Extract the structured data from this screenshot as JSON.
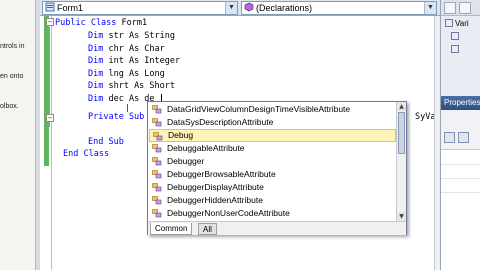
{
  "toolbox": {
    "text_lines": [
      "ntrols in",
      "en onto",
      "olbox."
    ]
  },
  "editor": {
    "class_dropdown": {
      "value": "Form1",
      "icon": "class-icon"
    },
    "method_dropdown": {
      "value": "(Declarations)",
      "icon": "method-icon"
    },
    "code_lines": [
      {
        "kw": "Public Class",
        "rest": " Form1"
      },
      {
        "kw": "Dim",
        "rest": " str As String"
      },
      {
        "kw": "Dim",
        "rest": " chr As Char"
      },
      {
        "kw": "Dim",
        "rest": " int As Integer"
      },
      {
        "kw": "Dim",
        "rest": " lng As Long"
      },
      {
        "kw": "Dim",
        "rest": " shrt As Short"
      },
      {
        "kw": "Dim",
        "rest": " dec As de"
      },
      {
        "kw": "Private Sub",
        "rest": ""
      },
      {
        "kw": "End Sub",
        "rest": ""
      },
      {
        "kw": "End Class",
        "rest": ""
      }
    ],
    "overflow_text": "SyVa"
  },
  "intellisense": {
    "items": [
      {
        "label": "DataGridViewColumnDesignTimeVisibleAttribute",
        "icon": "class-icon"
      },
      {
        "label": "DataSysDescriptionAttribute",
        "icon": "class-icon"
      },
      {
        "label": "Debug",
        "icon": "class-icon",
        "selected": true
      },
      {
        "label": "DebuggableAttribute",
        "icon": "class-icon"
      },
      {
        "label": "Debugger",
        "icon": "class-icon"
      },
      {
        "label": "DebuggerBrowsableAttribute",
        "icon": "class-icon"
      },
      {
        "label": "DebuggerDisplayAttribute",
        "icon": "class-icon"
      },
      {
        "label": "DebuggerHiddenAttribute",
        "icon": "class-icon"
      },
      {
        "label": "DebuggerNonUserCodeAttribute",
        "icon": "class-icon"
      }
    ],
    "tabs": {
      "common": "Common",
      "all": "All"
    }
  },
  "right_panel": {
    "tree_root": "Vari",
    "properties_title": "Properties"
  },
  "colors": {
    "keyword": "#0000ff",
    "selection": "#fff3b8",
    "outline_bar": "#5fb65f"
  }
}
